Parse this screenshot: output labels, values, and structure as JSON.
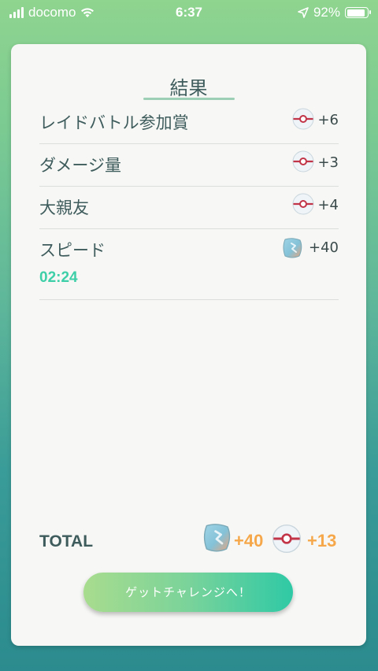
{
  "status_bar": {
    "carrier": "docomo",
    "time": "6:37",
    "battery_percent": "92%",
    "battery_level": 0.92,
    "icons": [
      "signal-icon",
      "wifi-icon",
      "location-arrow-icon",
      "battery-icon"
    ]
  },
  "result_card": {
    "title": "結果",
    "rows": [
      {
        "label": "レイドバトル参加賞",
        "icon": "premier-ball-icon",
        "value": "+6"
      },
      {
        "label": "ダメージ量",
        "icon": "premier-ball-icon",
        "value": "+3"
      },
      {
        "label": "大親友",
        "icon": "premier-ball-icon",
        "value": "+4"
      },
      {
        "label": "スピード",
        "icon": "rare-candy-icon",
        "value": "+40",
        "time": "02:24"
      }
    ],
    "total": {
      "label": "TOTAL",
      "candy_value": "+40",
      "ball_value": "+13"
    },
    "cta_label": "ゲットチャレンジへ！"
  },
  "colors": {
    "time_accent": "#3ecfa8",
    "total_accent": "#f5a749",
    "button_gradient_start": "#a8dc8e",
    "button_gradient_end": "#2fc9a5"
  }
}
